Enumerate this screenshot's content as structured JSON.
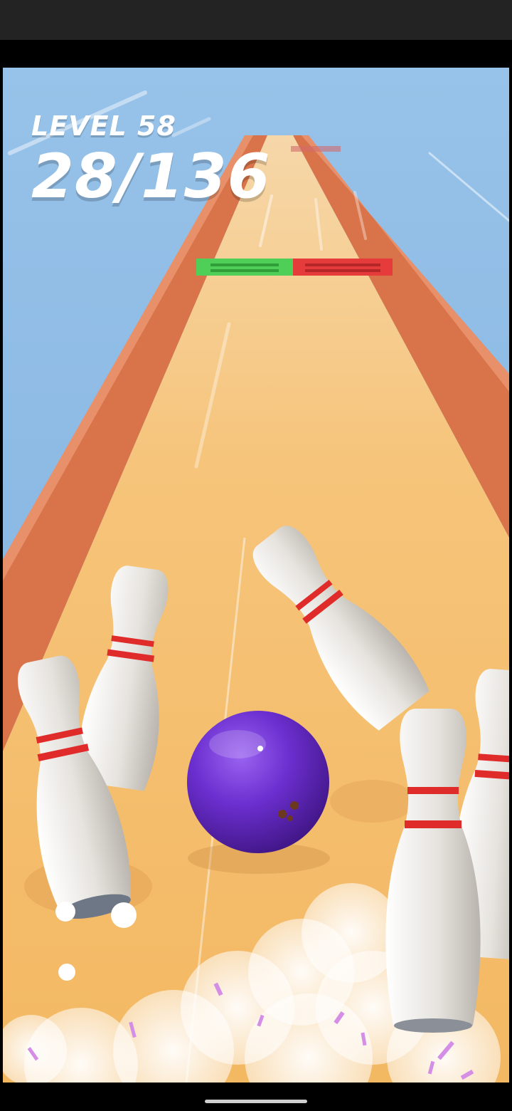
{
  "hud": {
    "level_label": "LEVEL 58",
    "progress_text": "28/136"
  },
  "game": {
    "pins_knocked": 28,
    "pins_total": 136,
    "gates": [
      {
        "type": "bonus",
        "color": "#4fcf57"
      },
      {
        "type": "penalty",
        "color": "#e53b3b"
      }
    ],
    "ball_color": "#6a2fc4",
    "lane_color": "#f4bd68",
    "wall_color": "#d9744a",
    "sky_color": "#8fbde6"
  }
}
